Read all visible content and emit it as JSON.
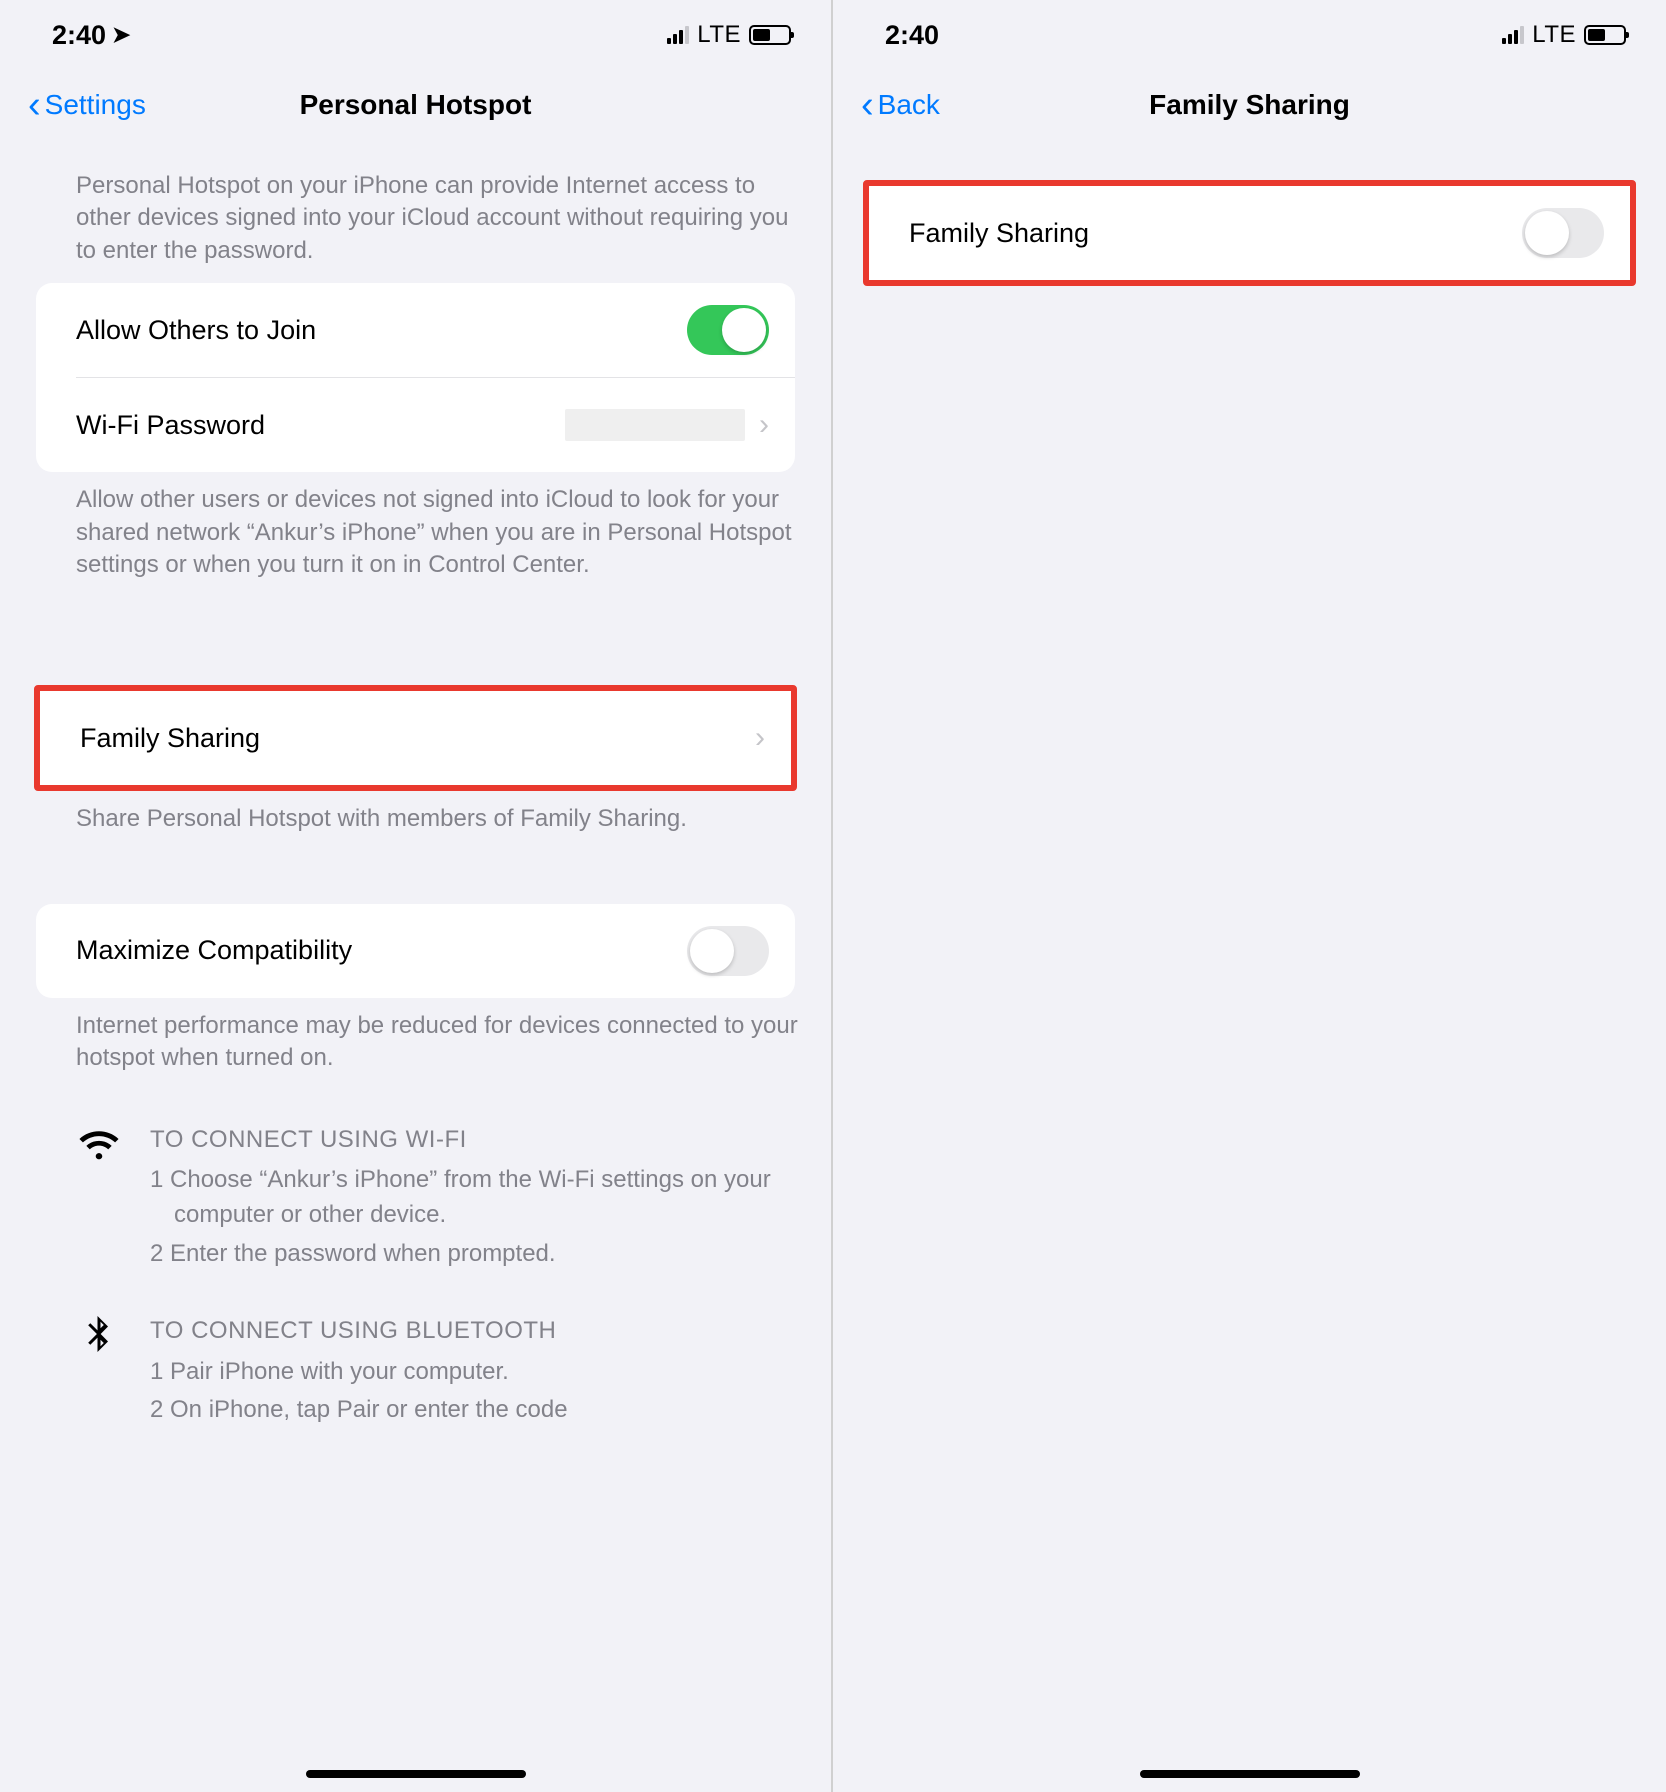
{
  "status": {
    "time": "2:40",
    "lte": "LTE"
  },
  "left": {
    "back": "Settings",
    "title": "Personal Hotspot",
    "intro": "Personal Hotspot on your iPhone can provide Internet access to other devices signed into your iCloud account without requiring you to enter the password.",
    "allow_label": "Allow Others to Join",
    "wifi_label": "Wi-Fi Password",
    "allow_desc": "Allow other users or devices not signed into iCloud to look for your shared network “Ankur’s iPhone” when you are in Personal Hotspot settings or when you turn it on in Control Center.",
    "family_label": "Family Sharing",
    "family_desc": "Share Personal Hotspot with members of Family Sharing.",
    "maxcompat_label": "Maximize Compatibility",
    "maxcompat_desc": "Internet performance may be reduced for devices connected to your hotspot when turned on.",
    "wifi_instr_title": "TO CONNECT USING WI-FI",
    "wifi_instr_1": "1 Choose “Ankur’s iPhone” from the Wi-Fi settings on your computer or other device.",
    "wifi_instr_2": "2 Enter the password when prompted.",
    "bt_instr_title": "TO CONNECT USING BLUETOOTH",
    "bt_instr_1": "1 Pair iPhone with your computer.",
    "bt_instr_2": "2 On iPhone, tap Pair or enter the code"
  },
  "right": {
    "back": "Back",
    "title": "Family Sharing",
    "row_label": "Family Sharing"
  }
}
